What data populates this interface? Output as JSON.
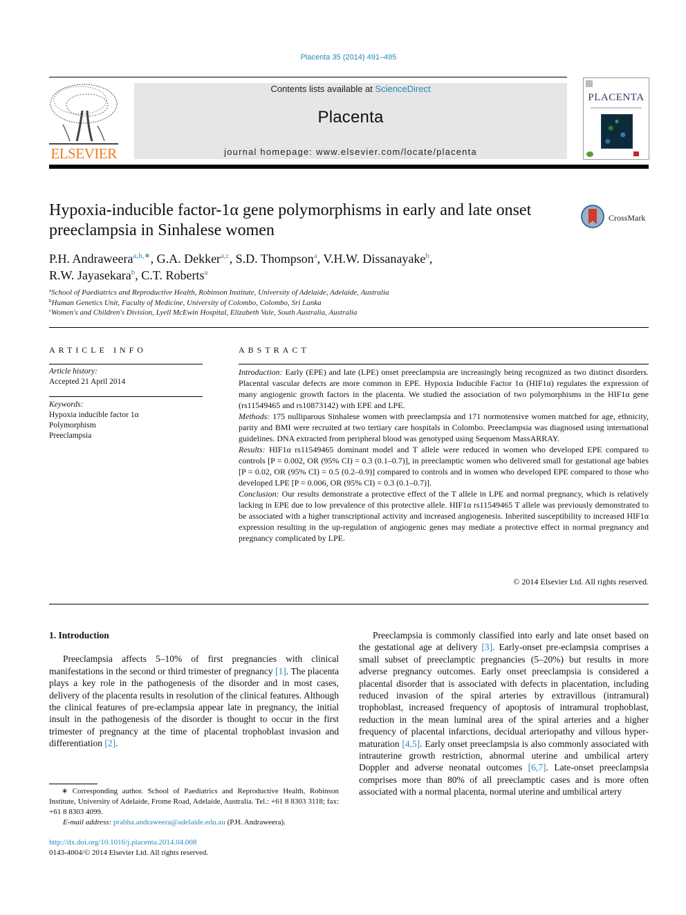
{
  "header": {
    "journal_ref": "Placenta 35 (2014) 491–495",
    "contents_prefix": "Contents lists available at ",
    "contents_link": "ScienceDirect",
    "journal_title": "Placenta",
    "homepage": "journal homepage: www.elsevier.com/locate/placenta",
    "publisher_logo": "ELSEVIER",
    "cover_title": "PLACENTA",
    "crossmark_label": "CrossMark"
  },
  "article": {
    "title": "Hypoxia-inducible factor-1α gene polymorphisms in early and late onset preeclampsia in Sinhalese women",
    "authors": [
      {
        "name": "P.H. Andraweera",
        "sup": "a,b,∗",
        "sep": ", "
      },
      {
        "name": "G.A. Dekker",
        "sup": "a,c",
        "sep": ", "
      },
      {
        "name": "S.D. Thompson",
        "sup": "a",
        "sep": ", "
      },
      {
        "name": "V.H.W. Dissanayake",
        "sup": "b",
        "sep": ","
      },
      {
        "name": "R.W. Jayasekara",
        "sup": "b",
        "sep": ", "
      },
      {
        "name": "C.T. Roberts",
        "sup": "a",
        "sep": ""
      }
    ],
    "affiliations": [
      {
        "key": "a",
        "text": "School of Paediatrics and Reproductive Health, Robinson Institute, University of Adelaide, Adelaide, Australia"
      },
      {
        "key": "b",
        "text": "Human Genetics Unit, Faculty of Medicine, University of Colombo, Colombo, Sri Lanka"
      },
      {
        "key": "c",
        "text": "Women's and Children's Division, Lyell McEwin Hospital, Elizabeth Vale, South Australia, Australia"
      }
    ]
  },
  "article_info": {
    "heading": "ARTICLE INFO",
    "history_label": "Article history:",
    "history_value": "Accepted 21 April 2014",
    "keywords_label": "Keywords:",
    "keywords": [
      "Hypoxia inducible factor 1α",
      "Polymorphism",
      "Preeclampsia"
    ]
  },
  "abstract": {
    "heading": "ABSTRACT",
    "sections": [
      {
        "label": "Introduction:",
        "text": "Early (EPE) and late (LPE) onset preeclampsia are increasingly being recognized as two distinct disorders. Placental vascular defects are more common in EPE. Hypoxia Inducible Factor 1α (HIF1α) regulates the expression of many angiogenic growth factors in the placenta. We studied the association of two polymorphisms in the HIF1α gene (rs11549465 and rs10873142) with EPE and LPE."
      },
      {
        "label": "Methods:",
        "text": "175 nulliparous Sinhalese women with preeclampsia and 171 normotensive women matched for age, ethnicity, parity and BMI were recruited at two tertiary care hospitals in Colombo. Preeclampsia was diagnosed using international guidelines. DNA extracted from peripheral blood was genotyped using Sequenom MassARRAY."
      },
      {
        "label": "Results:",
        "text": "HIF1α rs11549465 dominant model and T allele were reduced in women who developed EPE compared to controls [P = 0.002, OR (95% CI) = 0.3 (0.1–0.7)], in preeclamptic women who delivered small for gestational age babies [P = 0.02, OR (95% CI) = 0.5 (0.2–0.9)] compared to controls and in women who developed EPE compared to those who developed LPE [P = 0.006, OR (95% CI) = 0.3 (0.1–0.7)]."
      },
      {
        "label": "Conclusion:",
        "text": "Our results demonstrate a protective effect of the T allele in LPE and normal pregnancy, which is relatively lacking in EPE due to low prevalence of this protective allele. HIF1α rs11549465 T allele was previously demonstrated to be associated with a higher transcriptional activity and increased angiogenesis. Inherited susceptibility to increased HIF1α expression resulting in the up-regulation of angiogenic genes may mediate a protective effect in normal pregnancy and pregnancy complicated by LPE."
      }
    ],
    "copyright": "© 2014 Elsevier Ltd. All rights reserved."
  },
  "body": {
    "section_heading": "1.  Introduction",
    "left_para": [
      {
        "t": "Preeclampsia affects 5–10% of first pregnancies with clinical manifestations in the second or third trimester of pregnancy "
      },
      {
        "ref": "[1]"
      },
      {
        "t": ". The placenta plays a key role in the pathogenesis of the disorder and in most cases, delivery of the placenta results in resolution of the clinical features. Although the clinical features of pre-eclampsia appear late in pregnancy, the initial insult in the pathogenesis of the disorder is thought to occur in the first trimester of pregnancy at the time of placental trophoblast invasion and differentiation "
      },
      {
        "ref": "[2]"
      },
      {
        "t": "."
      }
    ],
    "right_para": [
      {
        "t": "Preeclampsia is commonly classified into early and late onset based on the gestational age at delivery "
      },
      {
        "ref": "[3]"
      },
      {
        "t": ". Early-onset pre-eclampsia comprises a small subset of preeclamptic pregnancies (5–20%) but results in more adverse pregnancy outcomes. Early onset preeclampsia is considered a placental disorder that is associated with defects in placentation, including reduced invasion of the spiral arteries by extravillous (intramural) trophoblast, increased frequency of apoptosis of intramural trophoblast, reduction in the mean luminal area of the spiral arteries and a higher frequency of placental infarctions, decidual arteriopathy and villous hyper-maturation "
      },
      {
        "ref": "[4,5]"
      },
      {
        "t": ". Early onset preeclampsia is also commonly associated with intrauterine growth restriction, abnormal uterine and umbilical artery Doppler and adverse neonatal outcomes "
      },
      {
        "ref": "[6,7]"
      },
      {
        "t": ". Late-onset preeclampsia comprises more than 80% of all preeclamptic cases and is more often associated with a normal placenta, normal uterine and umbilical artery"
      }
    ]
  },
  "footnote": {
    "corresponding": "∗  Corresponding author. School of Paediatrics and Reproductive Health, Robinson Institute, University of Adelaide, Frome Road, Adelaide, Australia. Tel.: +61 8 8303 3118; fax: +61 8 8303 4099.",
    "email_label": "E-mail address:",
    "email": "prabha.andraweera@adelaide.edu.au",
    "email_suffix": " (P.H. Andraweera).",
    "doi": "http://dx.doi.org/10.1016/j.placenta.2014.04.008",
    "issn": "0143-4004/© 2014 Elsevier Ltd. All rights reserved."
  }
}
